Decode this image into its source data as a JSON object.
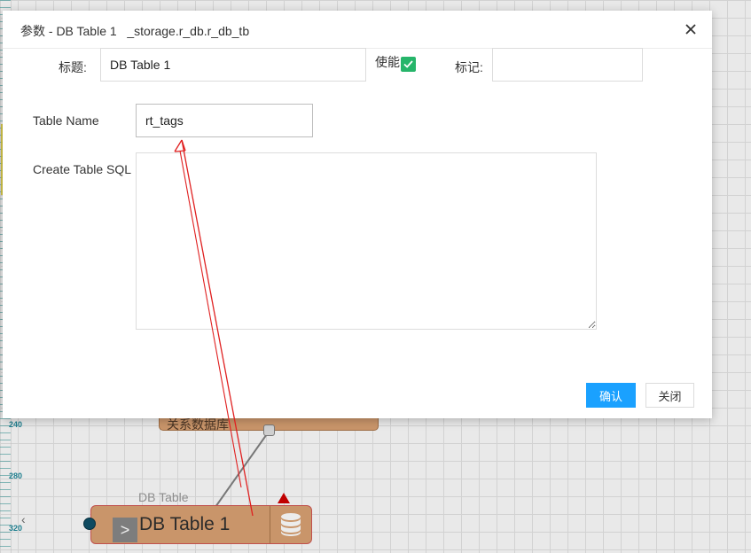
{
  "canvas": {
    "ruler_labels": [
      "240",
      "280",
      "320"
    ],
    "storage_node_label": "关系数据库",
    "db_node_type_label": "DB Table",
    "db_node_title": "DB Table 1",
    "expand_glyph": ">"
  },
  "dialog": {
    "title": "参数 - DB Table 1   _storage.r_db.r_db_tb",
    "fields": {
      "title_label": "标题:",
      "title_value": "DB Table 1",
      "enable_label": "使能",
      "enabled": true,
      "tag_label": "标记:",
      "tag_value": "",
      "table_name_label": "Table Name",
      "table_name_value": "rt_tags",
      "create_sql_label": "Create Table SQL",
      "create_sql_value": ""
    },
    "buttons": {
      "confirm_label": "确认",
      "close_label": "关闭"
    }
  },
  "colors": {
    "primary_button": "#1aa1ff",
    "checkbox": "#26b56a",
    "node_fill": "#c9956a",
    "annotation_arrow": "#e02020"
  }
}
